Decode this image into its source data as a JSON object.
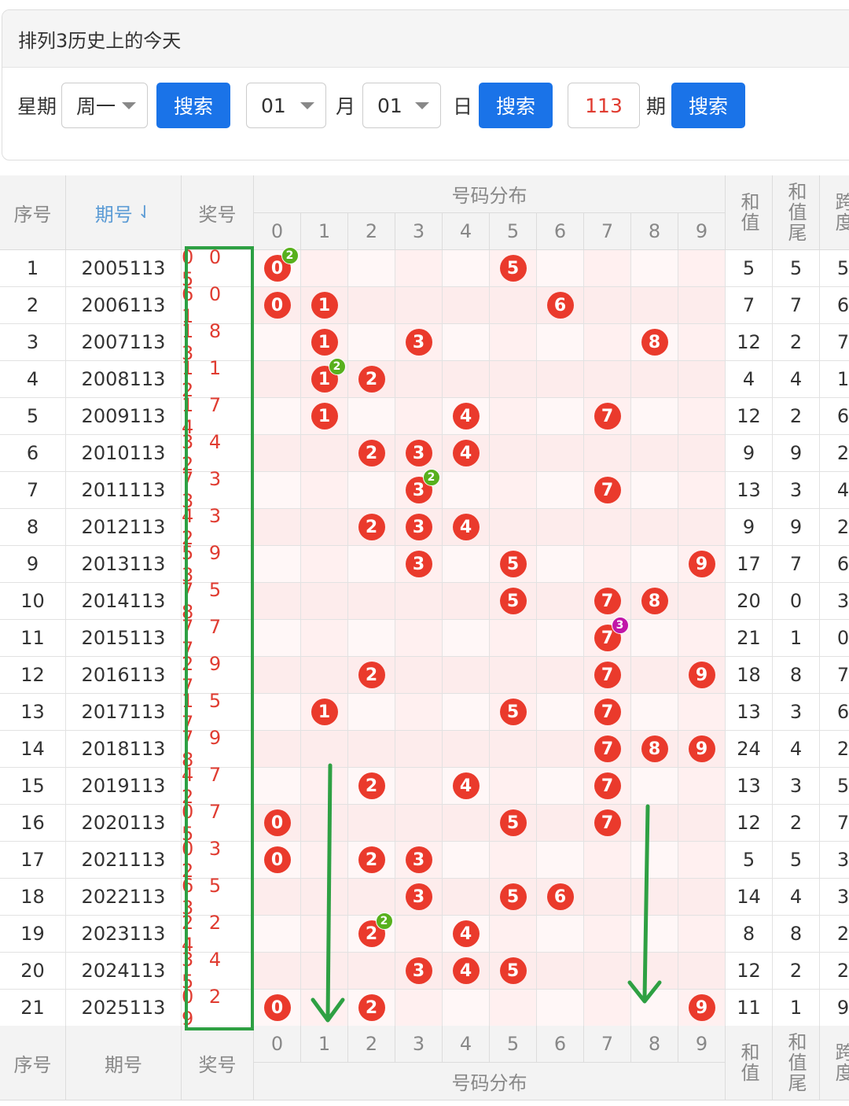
{
  "page_title": "排列3历史上的今天",
  "controls": {
    "week_label": "星期",
    "week_value": "周一",
    "search_label": "搜索",
    "month_value": "01",
    "month_label": "月",
    "day_value": "01",
    "day_label": "日",
    "issue_value": "113",
    "issue_label": "期"
  },
  "table": {
    "headers": {
      "index": "序号",
      "issue": "期号",
      "award": "奖号",
      "distribution": "号码分布",
      "sum": "和值",
      "sum_tail": "和值尾",
      "span": "跨度",
      "digits": [
        "0",
        "1",
        "2",
        "3",
        "4",
        "5",
        "6",
        "7",
        "8",
        "9"
      ]
    },
    "rows": [
      {
        "index": "1",
        "issue": "2005113",
        "award": "005",
        "sum": "5",
        "tail": "5",
        "span": "5",
        "balls": [
          {
            "d": 0,
            "rep": "2",
            "rc": "green"
          },
          {
            "d": 5
          }
        ]
      },
      {
        "index": "2",
        "issue": "2006113",
        "award": "601",
        "sum": "7",
        "tail": "7",
        "span": "6",
        "balls": [
          {
            "d": 0
          },
          {
            "d": 1
          },
          {
            "d": 6
          }
        ]
      },
      {
        "index": "3",
        "issue": "2007113",
        "award": "183",
        "sum": "12",
        "tail": "2",
        "span": "7",
        "balls": [
          {
            "d": 1
          },
          {
            "d": 3
          },
          {
            "d": 8
          }
        ]
      },
      {
        "index": "4",
        "issue": "2008113",
        "award": "112",
        "sum": "4",
        "tail": "4",
        "span": "1",
        "balls": [
          {
            "d": 1,
            "rep": "2",
            "rc": "green"
          },
          {
            "d": 2
          }
        ]
      },
      {
        "index": "5",
        "issue": "2009113",
        "award": "174",
        "sum": "12",
        "tail": "2",
        "span": "6",
        "balls": [
          {
            "d": 1
          },
          {
            "d": 4
          },
          {
            "d": 7
          }
        ]
      },
      {
        "index": "6",
        "issue": "2010113",
        "award": "342",
        "sum": "9",
        "tail": "9",
        "span": "2",
        "balls": [
          {
            "d": 2
          },
          {
            "d": 3
          },
          {
            "d": 4
          }
        ]
      },
      {
        "index": "7",
        "issue": "2011113",
        "award": "733",
        "sum": "13",
        "tail": "3",
        "span": "4",
        "balls": [
          {
            "d": 3,
            "rep": "2",
            "rc": "green"
          },
          {
            "d": 7
          }
        ]
      },
      {
        "index": "8",
        "issue": "2012113",
        "award": "432",
        "sum": "9",
        "tail": "9",
        "span": "2",
        "balls": [
          {
            "d": 2
          },
          {
            "d": 3
          },
          {
            "d": 4
          }
        ]
      },
      {
        "index": "9",
        "issue": "2013113",
        "award": "593",
        "sum": "17",
        "tail": "7",
        "span": "6",
        "balls": [
          {
            "d": 3
          },
          {
            "d": 5
          },
          {
            "d": 9
          }
        ]
      },
      {
        "index": "10",
        "issue": "2014113",
        "award": "758",
        "sum": "20",
        "tail": "0",
        "span": "3",
        "balls": [
          {
            "d": 5
          },
          {
            "d": 7
          },
          {
            "d": 8
          }
        ]
      },
      {
        "index": "11",
        "issue": "2015113",
        "award": "777",
        "sum": "21",
        "tail": "1",
        "span": "0",
        "balls": [
          {
            "d": 7,
            "rep": "3",
            "rc": "purple"
          }
        ]
      },
      {
        "index": "12",
        "issue": "2016113",
        "award": "297",
        "sum": "18",
        "tail": "8",
        "span": "7",
        "balls": [
          {
            "d": 2
          },
          {
            "d": 7
          },
          {
            "d": 9
          }
        ]
      },
      {
        "index": "13",
        "issue": "2017113",
        "award": "157",
        "sum": "13",
        "tail": "3",
        "span": "6",
        "balls": [
          {
            "d": 1
          },
          {
            "d": 5
          },
          {
            "d": 7
          }
        ]
      },
      {
        "index": "14",
        "issue": "2018113",
        "award": "798",
        "sum": "24",
        "tail": "4",
        "span": "2",
        "balls": [
          {
            "d": 7
          },
          {
            "d": 8
          },
          {
            "d": 9
          }
        ]
      },
      {
        "index": "15",
        "issue": "2019113",
        "award": "472",
        "sum": "13",
        "tail": "3",
        "span": "5",
        "balls": [
          {
            "d": 2
          },
          {
            "d": 4
          },
          {
            "d": 7
          }
        ]
      },
      {
        "index": "16",
        "issue": "2020113",
        "award": "075",
        "sum": "12",
        "tail": "2",
        "span": "7",
        "balls": [
          {
            "d": 0
          },
          {
            "d": 5
          },
          {
            "d": 7
          }
        ]
      },
      {
        "index": "17",
        "issue": "2021113",
        "award": "032",
        "sum": "5",
        "tail": "5",
        "span": "3",
        "balls": [
          {
            "d": 0
          },
          {
            "d": 2
          },
          {
            "d": 3
          }
        ]
      },
      {
        "index": "18",
        "issue": "2022113",
        "award": "653",
        "sum": "14",
        "tail": "4",
        "span": "3",
        "balls": [
          {
            "d": 3
          },
          {
            "d": 5
          },
          {
            "d": 6
          }
        ]
      },
      {
        "index": "19",
        "issue": "2023113",
        "award": "224",
        "sum": "8",
        "tail": "8",
        "span": "2",
        "balls": [
          {
            "d": 2,
            "rep": "2",
            "rc": "green"
          },
          {
            "d": 4
          }
        ]
      },
      {
        "index": "20",
        "issue": "2024113",
        "award": "345",
        "sum": "12",
        "tail": "2",
        "span": "2",
        "balls": [
          {
            "d": 3
          },
          {
            "d": 4
          },
          {
            "d": 5
          }
        ]
      },
      {
        "index": "21",
        "issue": "2025113",
        "award": "029",
        "sum": "11",
        "tail": "1",
        "span": "9",
        "balls": [
          {
            "d": 0
          },
          {
            "d": 2
          },
          {
            "d": 9
          }
        ]
      }
    ]
  },
  "colors": {
    "ball": "#ea3a2c",
    "highlight_green": "#2ea043",
    "accent_blue": "#1a73e8"
  }
}
